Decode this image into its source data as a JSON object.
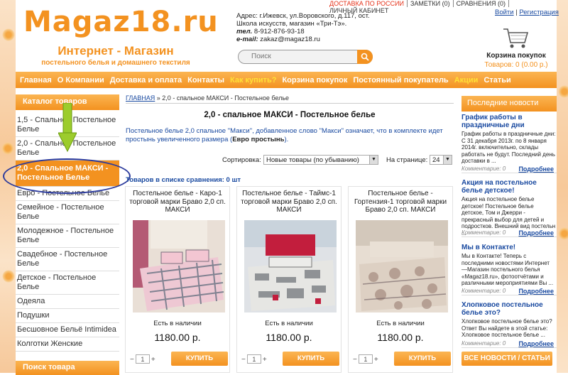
{
  "header": {
    "logo_title": "Magaz18.ru",
    "logo_sub1": "Интернет - Магазин",
    "logo_sub2": "постельного белья и домашнего текстиля",
    "address1": "Адрес: г.Ижевск, ул.Воровского, д.117, ост.",
    "address2": "Школа искусств, магазин «Три-Тэ».",
    "phone_label": "тел.",
    "phone": " 8-912-876-93-18",
    "email_label": "e-mail:",
    "email": " zakaz@magaz18.ru",
    "search_placeholder": "Поиск",
    "toplinks": [
      "ДОСТАВКА ПО РОССИИ",
      "ЗАМЕТКИ (0)",
      "СРАВНЕНИЯ (0)",
      "ЛИЧНЫЙ КАБИНЕТ"
    ],
    "login": "Войти",
    "register": "Регистрация",
    "cart_title": "Корзина покупок",
    "cart_sum": "Товаров: 0 (0.00 р.)",
    "accent": "#f39220",
    "link_color": "#1a4aa0"
  },
  "nav": [
    "Главная",
    "О Компании",
    "Доставка и оплата",
    "Контакты",
    "Как купить?",
    "Корзина покупок",
    "Постоянный покупатель",
    "Акции",
    "Статьи"
  ],
  "sidebar": {
    "catalog_title": "Каталог товаров",
    "items": [
      "1,5 - Спальное Постельное Белье",
      "2,0 - Спальное Постельное Белье",
      "2,0 - Спальное МАКСИ - Постельное Белье",
      "Евро - Постельное Белье",
      "Семейное - Постельное Белье",
      "Молодежное - Постельное Белье",
      "Свадебное - Постельное Белье",
      "Детское - Постельное Белье",
      "Одеяла",
      "Подушки",
      "Бесшовное Бельё Intimidea",
      "Колготки Женские"
    ],
    "search_title": "Поиск товара"
  },
  "main": {
    "breadcrumb_home": "ГЛАВНАЯ",
    "breadcrumb_current": " » 2,0 - спальное МАКСИ - Постельное белье",
    "title": "2,0 - спальное МАКСИ - Постельное белье",
    "description": "Постельное белье 2,0 спальное \"Макси\", добавленное слово \"Макси\" означает, что в комплекте идет простынь увеличенного размера (",
    "description_bold": "Евро простынь",
    "description_end": ").",
    "sort_label": "Сортировка:",
    "sort_value": "Новые товары (по убыванию)",
    "per_page_label": "На странице:",
    "per_page_value": "24",
    "compare_text": "Товаров в списке сравнения: 0 шт"
  },
  "products": [
    {
      "title": "Постельное белье - Каро-1 торговой марки Браво 2,0 сп. МАКСИ",
      "stock": "Есть в наличии",
      "price": "1180.00 р.",
      "qty": "1",
      "buy": "КУПИТЬ"
    },
    {
      "title": "Постельное белье - Таймс-1 торговой марки Браво 2,0 сп. МАКСИ",
      "stock": "Есть в наличии",
      "price": "1180.00 р.",
      "qty": "1",
      "buy": "КУПИТЬ"
    },
    {
      "title": "Постельное белье - Гортензия-1 торговой марки Браво 2,0 сп. МАКСИ",
      "stock": "Есть в наличии",
      "price": "1180.00 р.",
      "qty": "1",
      "buy": "КУПИТЬ"
    }
  ],
  "news": {
    "title": "Последние новости",
    "items": [
      {
        "title": "График работы в праздничные дни",
        "text": "График работы в праздничные дни: С 31 декабря 2013г. по 8 января 2014г. включительно, склады работать не будут. Последний день доставки в ...",
        "comments": "Комментарие: 0",
        "more": "Подробнее"
      },
      {
        "title": "Акция на постельное белье детское!",
        "text": "Акция на постельное белье детское! Постельное белье детское, Том и Джерри - прекрасный выбор для детей и подростков. Внешний вид постельн ...",
        "comments": "Комментарие: 0",
        "more": "Подробнее"
      },
      {
        "title": "Мы в Контакте!",
        "text": "Мы в Контакте!  Теперь с последними новостями Интернет —Магазин постельного белья «Magaz18.ru», фотоотчётами и различными мероприятиями Вы ...",
        "comments": "Комментарие: 0",
        "more": "Подробнее"
      },
      {
        "title": "Хлопковое постельное белье это?",
        "text": "Хлопковое постельное белье  это? Ответ Вы найдете в этой статье: Хлопковое постельное белье ...",
        "comments": "Комментарие: 0",
        "more": "Подробнее"
      }
    ],
    "all_news": "ВСЕ НОВОСТИ / СТАТЬИ"
  }
}
